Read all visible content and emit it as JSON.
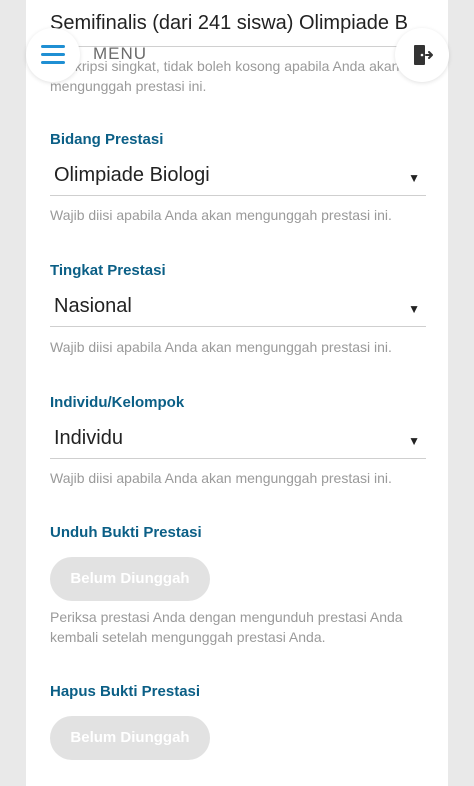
{
  "header": {
    "menu_label": "MENU",
    "icons": {
      "menu": "hamburger-icon",
      "logout": "logout-icon"
    },
    "accent_color": "#1f8fd3"
  },
  "form": {
    "title_value": "Semifinalis (dari 241 siswa) Olimpiade B",
    "description_help": "Deskripsi singkat, tidak boleh kosong apabila Anda akan mengunggah prestasi ini.",
    "fields": [
      {
        "label": "Bidang Prestasi",
        "value": "Olimpiade Biologi",
        "help": "Wajib diisi apabila Anda akan mengunggah prestasi ini."
      },
      {
        "label": "Tingkat Prestasi",
        "value": "Nasional",
        "help": "Wajib diisi apabila Anda akan mengunggah prestasi ini."
      },
      {
        "label": "Individu/Kelompok",
        "value": "Individu",
        "help": "Wajib diisi apabila Anda akan mengunggah prestasi ini."
      }
    ],
    "download": {
      "label": "Unduh Bukti Prestasi",
      "button": "Belum Diunggah",
      "help": "Periksa prestasi Anda dengan mengunduh prestasi Anda kembali setelah mengunggah prestasi Anda."
    },
    "delete": {
      "label": "Hapus Bukti Prestasi",
      "button": "Belum Diunggah"
    },
    "label_color": "#0b5f86"
  }
}
